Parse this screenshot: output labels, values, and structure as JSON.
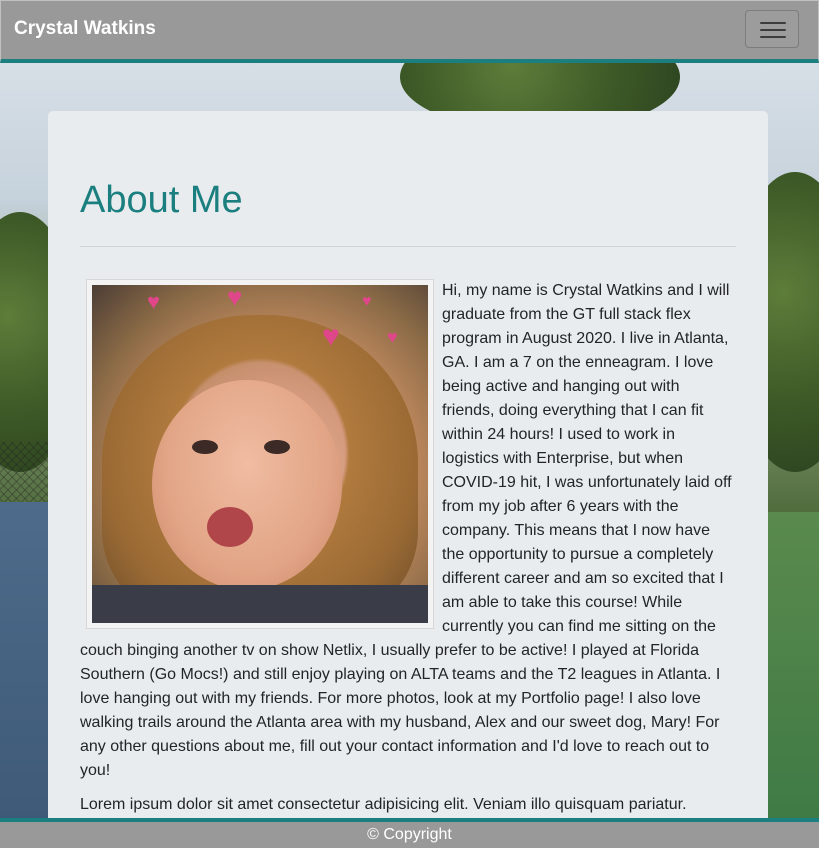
{
  "navbar": {
    "brand": "Crystal Watkins",
    "toggle_icon": "hamburger-menu-icon"
  },
  "about": {
    "heading": "About Me",
    "photo_icon": "profile-photo",
    "paragraph1": "Hi, my name is Crystal Watkins and I will graduate from the GT full stack flex program in August 2020. I live in Atlanta, GA. I am a 7 on the enneagram. I love being active and hanging out with friends, doing everything that I can fit within 24 hours! I used to work in logistics with Enterprise, but when COVID-19 hit, I was unfortunately laid off from my job after 6 years with the company. This means that I now have the opportunity to pursue a completely different career and am so excited that I am able to take this course! While currently you can find me sitting on the couch binging another tv on show Netlix, I usually prefer to be active! I played at Florida Southern (Go Mocs!) and still enjoy playing on ALTA teams and the T2 leagues in Atlanta. I love hanging out with my friends. For more photos, look at my Portfolio page! I also love walking trails around the Atlanta area with my husband, Alex and our sweet dog, Mary! For any other questions about me, fill out your contact information and I'd love to reach out to you!",
    "paragraph2": "Lorem ipsum dolor sit amet consectetur adipisicing elit. Veniam illo quisquam pariatur."
  },
  "footer": {
    "text": "© Copyright"
  },
  "colors": {
    "accent": "#1a7f7e",
    "navbar_bg": "#999999",
    "card_bg": "#e9ecef"
  }
}
